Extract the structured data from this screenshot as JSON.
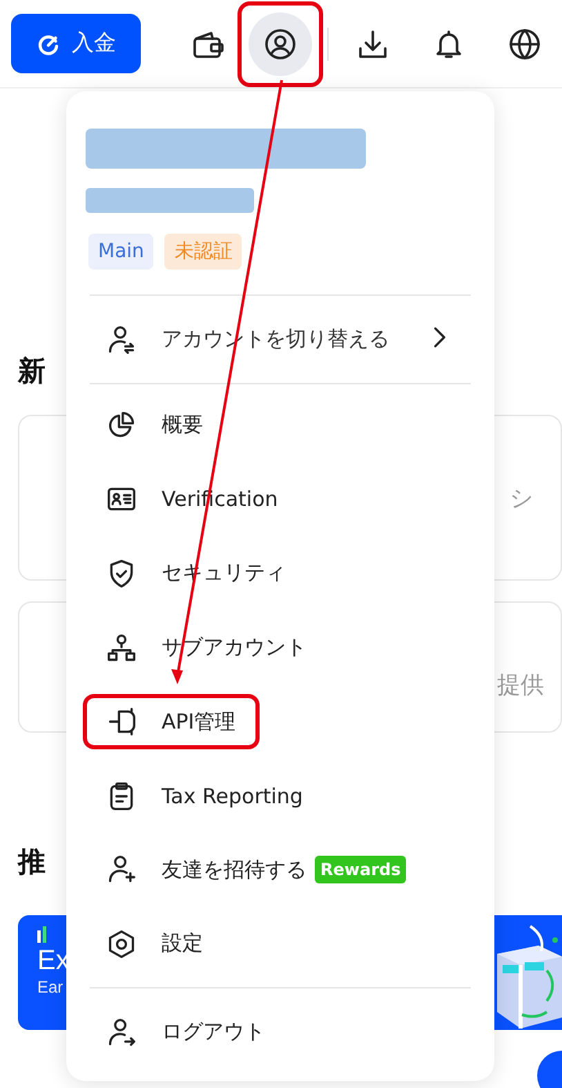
{
  "header": {
    "deposit_button": "入金",
    "avatar_highlighted": true
  },
  "background": {
    "section_1_heading": "新",
    "card_texts": [
      "シ",
      "提供"
    ],
    "section_2_heading": "推",
    "banner": {
      "title": "Ex",
      "subtitle": "Ear"
    }
  },
  "menu": {
    "badges": [
      {
        "label": "Main",
        "kind": "account"
      },
      {
        "label": "未認証",
        "kind": "warning"
      }
    ],
    "switch_account": "アカウントを切り替える",
    "items": [
      {
        "label": "概要",
        "kind": "pie",
        "highlighted": false
      },
      {
        "label": "Verification",
        "kind": "idcard",
        "highlighted": false
      },
      {
        "label": "セキュリティ",
        "kind": "shield",
        "highlighted": false
      },
      {
        "label": "サブアカウント",
        "kind": "tree",
        "highlighted": false
      },
      {
        "label": "API管理",
        "kind": "plug",
        "highlighted": true
      },
      {
        "label": "Tax Reporting",
        "kind": "clipboard",
        "highlighted": false
      },
      {
        "label": "友達を招待する",
        "kind": "invite",
        "highlighted": false,
        "badge": "Rewards"
      },
      {
        "label": "設定",
        "kind": "settings",
        "highlighted": false
      }
    ],
    "logout": "ログアウト"
  }
}
